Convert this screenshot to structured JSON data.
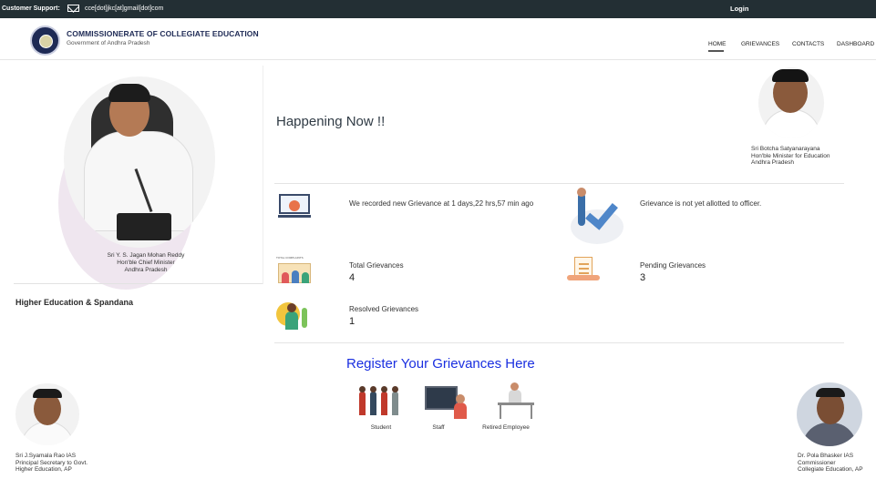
{
  "topbar": {
    "support_label": "Customer Support:",
    "email": "cce[dot]jkc[at]gmail[dot]com",
    "login": "Login"
  },
  "header": {
    "title": "COMMISSIONERATE OF COLLEGIATE EDUCATION",
    "subtitle": "Government of Andhra Pradesh",
    "nav": [
      "HOME",
      "GRIEVANCES",
      "CONTACTS",
      "DASHBOARD"
    ]
  },
  "left": {
    "cm_caption": [
      "Sri Y. S. Jagan Mohan Reddy",
      "Hon'ble Chief Minister",
      "Andhra Pradesh"
    ],
    "section_title": "Higher Education & Spandana"
  },
  "main": {
    "happening": "Happening Now !!",
    "minister_caption": [
      "Sri Botcha Satyanarayana",
      "Hon'ble Minister for Education",
      "Andhra Pradesh"
    ],
    "recorded_text": "We recorded new Grievance at 1 days,22 hrs,57 min ago",
    "not_allotted_text": "Grievance is not yet allotted to officer.",
    "total_label": "Total Grievances",
    "total_value": "4",
    "total_icon_label": "TOTAL COMPLAINTS",
    "pending_label": "Pending Grievances",
    "pending_value": "3",
    "resolved_label": "Resolved Grievances",
    "resolved_value": "1",
    "register_title": "Register Your Grievances Here",
    "register_options": [
      "Student",
      "Staff",
      "Retired Employee"
    ]
  },
  "officials": {
    "left_caption": [
      "Sri J.Syamala Rao IAS",
      "Principal Secretary to Govt.",
      "Higher Education, AP"
    ],
    "right_caption": [
      "Dr. Pola Bhasker IAS",
      "Commissioner",
      "Collegiate Education, AP"
    ]
  },
  "colors": {
    "topbar_bg": "#232f34",
    "register_link": "#1a2fe0",
    "brand_navy": "#1e2a55"
  },
  "icons": [
    "mail-icon",
    "laptop-user-icon",
    "checkmark-icon",
    "total-complaints-icon",
    "pending-document-icon",
    "resolved-person-icon",
    "students-icon",
    "staff-teacher-icon",
    "retired-employee-icon"
  ]
}
